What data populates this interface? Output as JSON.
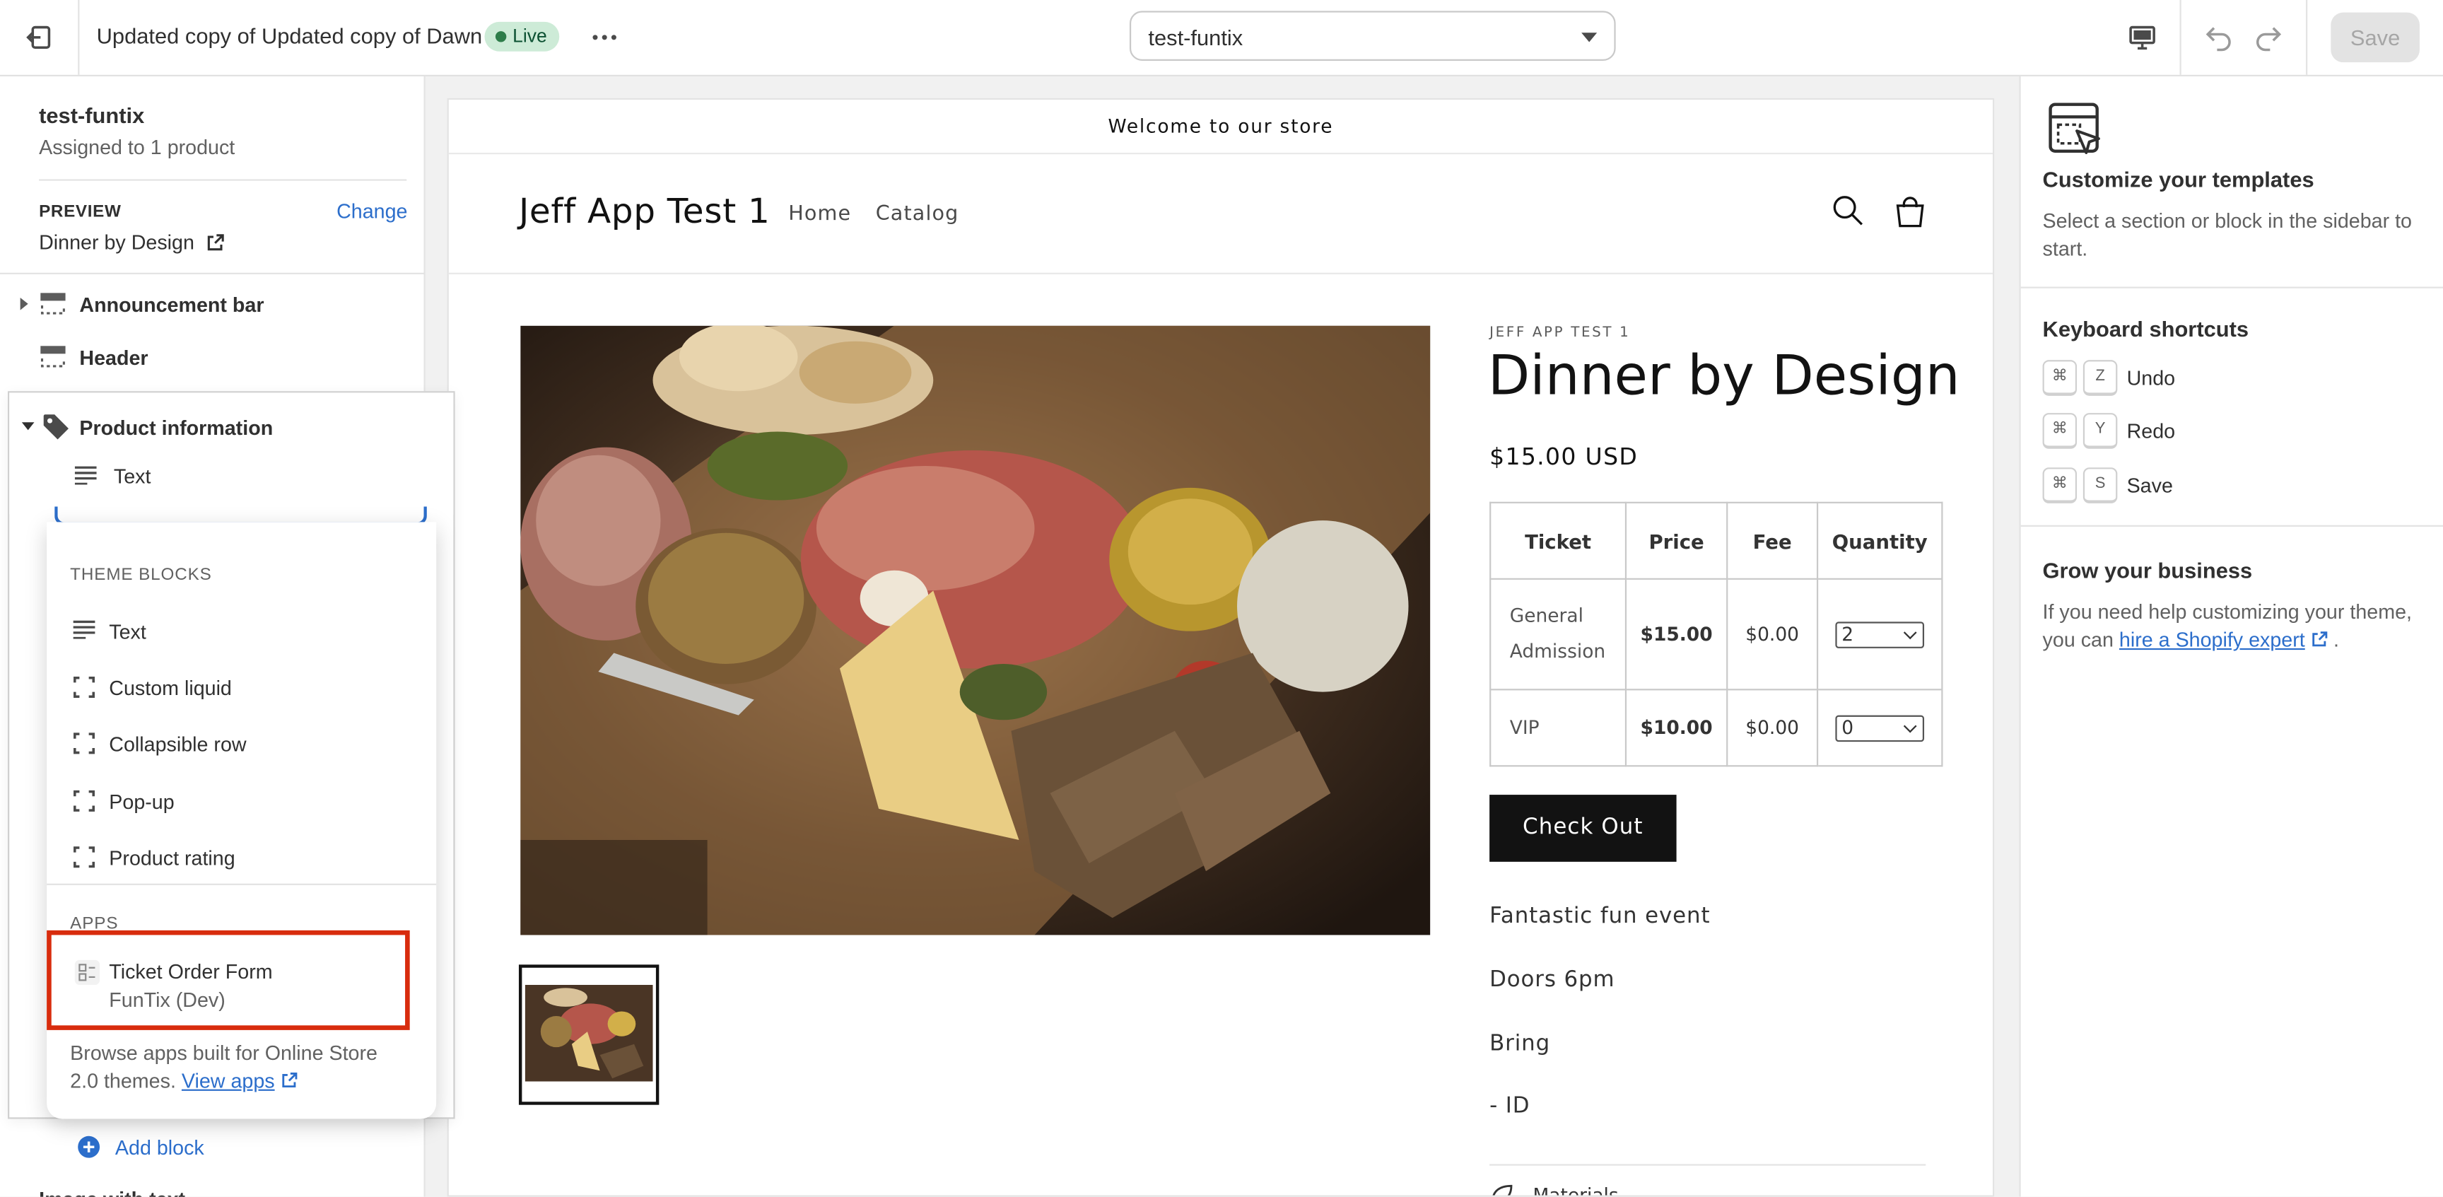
{
  "topbar": {
    "title": "Updated copy of Updated copy of Dawn",
    "status_badge": "Live",
    "template_select": "test-funtix",
    "save_label": "Save"
  },
  "sidebar": {
    "template_name": "test-funtix",
    "assigned": "Assigned to 1 product",
    "preview_label": "PREVIEW",
    "preview_change": "Change",
    "preview_value": "Dinner by Design",
    "sections": [
      {
        "label": "Announcement bar"
      },
      {
        "label": "Header"
      }
    ],
    "add_block": "Add block",
    "bottom_section": "Image with text"
  },
  "popover": {
    "section_title": "Product information",
    "child_block": "Text",
    "theme_blocks_header": "THEME BLOCKS",
    "theme_blocks": [
      {
        "label": "Text",
        "icon": "text-lines-icon"
      },
      {
        "label": "Custom liquid",
        "icon": "block-frame-icon"
      },
      {
        "label": "Collapsible row",
        "icon": "block-frame-icon"
      },
      {
        "label": "Pop-up",
        "icon": "block-frame-icon"
      },
      {
        "label": "Product rating",
        "icon": "block-frame-icon"
      }
    ],
    "apps_header": "APPS",
    "app_name": "Ticket Order Form",
    "app_vendor": "FunTix (Dev)",
    "footer_text": "Browse apps built for Online Store 2.0 themes.",
    "footer_link": "View apps",
    "highlight_color": "#d82c0d"
  },
  "store": {
    "announcement": "Welcome to our store",
    "logo": "Jeff App Test 1",
    "nav": [
      "Home",
      "Catalog"
    ],
    "vendor": "JEFF APP TEST 1",
    "product_title": "Dinner by Design",
    "price": "$15.00 USD",
    "ticket_table": {
      "headers": [
        "Ticket",
        "Price",
        "Fee",
        "Quantity"
      ],
      "rows": [
        {
          "name": "General Admission",
          "price": "$15.00",
          "fee": "$0.00",
          "qty": "2"
        },
        {
          "name": "VIP",
          "price": "$10.00",
          "fee": "$0.00",
          "qty": "0"
        }
      ]
    },
    "checkout_label": "Check Out",
    "description": [
      "Fantastic fun event",
      "Doors 6pm",
      "Bring",
      "- ID"
    ],
    "materials": "Materials"
  },
  "right_panel": {
    "customize_title": "Customize your templates",
    "customize_text": "Select a section or block in the sidebar to start.",
    "shortcuts_title": "Keyboard shortcuts",
    "shortcuts": [
      {
        "mod": "⌘",
        "key": "Z",
        "label": "Undo"
      },
      {
        "mod": "⌘",
        "key": "Y",
        "label": "Redo"
      },
      {
        "mod": "⌘",
        "key": "S",
        "label": "Save"
      }
    ],
    "grow_title": "Grow your business",
    "grow_text": "If you need help customizing your theme, you can",
    "grow_link": "hire a Shopify expert",
    "grow_end": "."
  },
  "colors": {
    "accent_blue": "#2c6ecb",
    "live_badge_bg": "#cdebd7",
    "checkout_bg": "#121212"
  }
}
